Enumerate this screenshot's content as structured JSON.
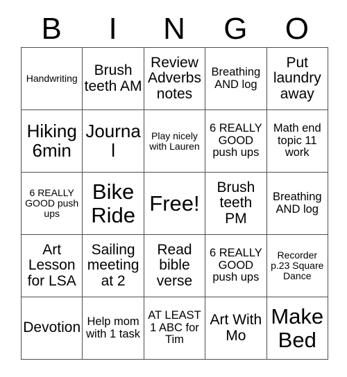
{
  "card": {
    "header_letters": [
      "B",
      "I",
      "N",
      "G",
      "O"
    ],
    "free_space_label": "Free!",
    "rows": [
      [
        {
          "text": "Handwriting",
          "size": "sm"
        },
        {
          "text": "Brush teeth AM",
          "size": "lg"
        },
        {
          "text": "Review Adverbs notes",
          "size": "lg"
        },
        {
          "text": "Breathing AND log",
          "size": "md"
        },
        {
          "text": "Put laundry away",
          "size": "lg"
        }
      ],
      [
        {
          "text": "Hiking 6min",
          "size": "xl"
        },
        {
          "text": "Journal",
          "size": "xl"
        },
        {
          "text": "Play nicely with Lauren",
          "size": "sm"
        },
        {
          "text": "6 REALLY GOOD push ups",
          "size": "md"
        },
        {
          "text": "Math end topic 11 work",
          "size": "md"
        }
      ],
      [
        {
          "text": "6 REALLY GOOD push ups",
          "size": "sm"
        },
        {
          "text": "Bike Ride",
          "size": "xxl"
        },
        {
          "text": "Free!",
          "size": "free"
        },
        {
          "text": "Brush teeth PM",
          "size": "lg"
        },
        {
          "text": "Breathing AND log",
          "size": "md"
        }
      ],
      [
        {
          "text": "Art Lesson for LSA",
          "size": "lg"
        },
        {
          "text": "Sailing meeting at 2",
          "size": "lg"
        },
        {
          "text": "Read bible verse",
          "size": "lg"
        },
        {
          "text": "6 REALLY GOOD push ups",
          "size": "md"
        },
        {
          "text": "Recorder p.23 Square Dance",
          "size": "sm"
        }
      ],
      [
        {
          "text": "Devotion",
          "size": "lg"
        },
        {
          "text": "Help mom with 1 task",
          "size": "md"
        },
        {
          "text": "AT LEAST 1 ABC for Tim",
          "size": "md"
        },
        {
          "text": "Art With Mo",
          "size": "lg"
        },
        {
          "text": "Make Bed",
          "size": "xxl"
        }
      ]
    ]
  },
  "colors": {
    "background": "#ffffff",
    "text": "#000000",
    "grid_line": "#4d4d4d"
  }
}
